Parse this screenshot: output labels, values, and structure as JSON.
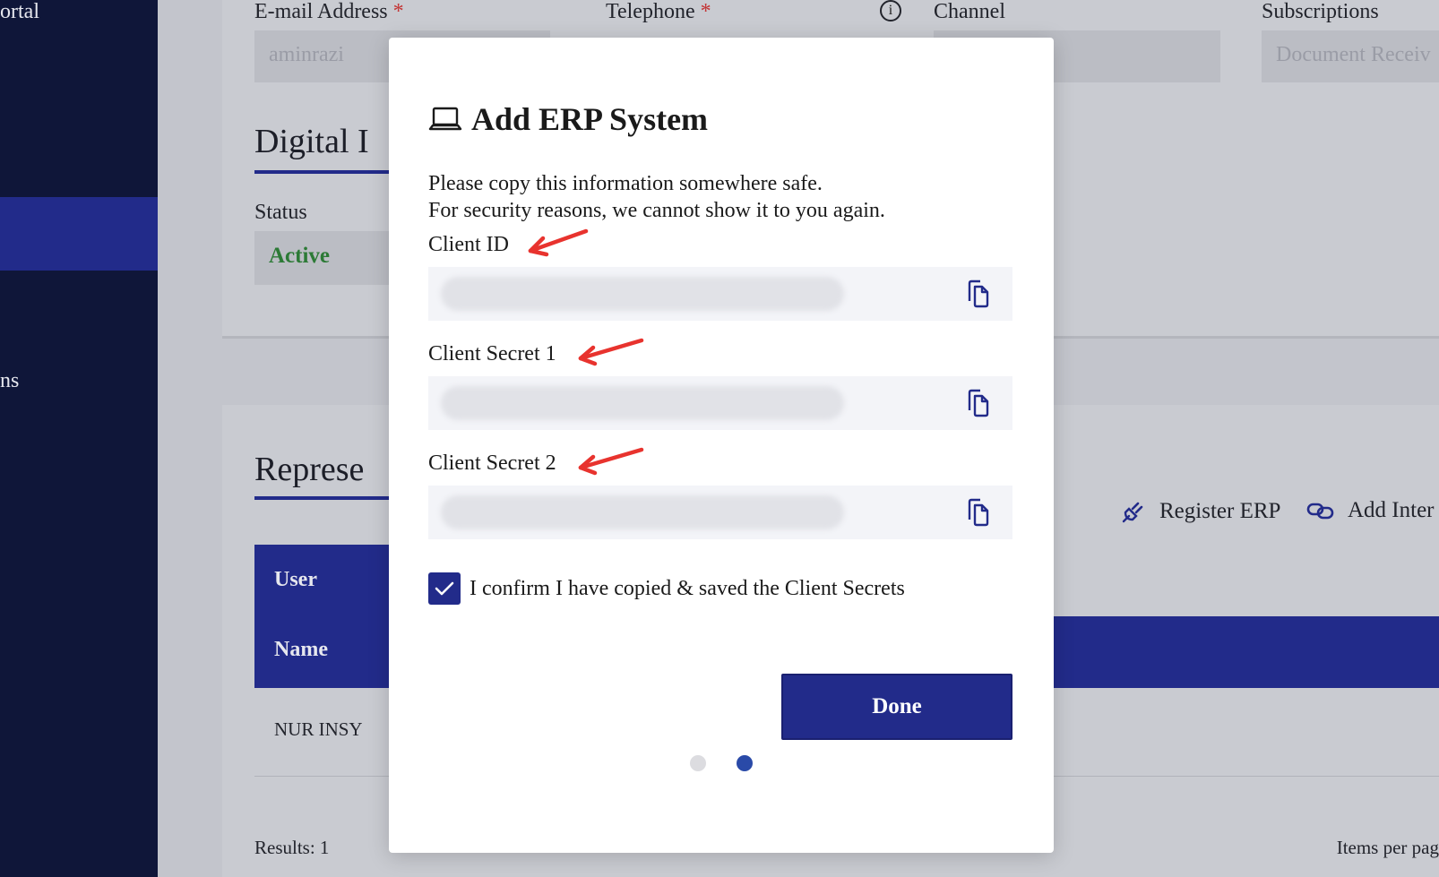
{
  "sidebar": {
    "item_portal": "ortal",
    "item_partial": "ns"
  },
  "form": {
    "email_label": "E-mail Address",
    "email_value": "aminrazi",
    "telephone_label": "Telephone",
    "required_mark": "*",
    "channel_label": "Channel",
    "subscriptions_label": "Subscriptions",
    "subscriptions_value": "Document Receiv"
  },
  "digital": {
    "title": "Digital I",
    "status_label": "Status",
    "status_value": "Active"
  },
  "representatives": {
    "title": "Represe",
    "header_user": "User",
    "header_name": "Name",
    "row_name": "NUR INSY",
    "register_erp": "Register ERP",
    "add_integration": "Add Inter",
    "results": "Results: 1",
    "items_per_page": "Items per pag"
  },
  "modal": {
    "title": "Add ERP System",
    "desc_line1": "Please copy this information somewhere safe.",
    "desc_line2": "For security reasons, we cannot show it to you again.",
    "client_id_label": "Client ID",
    "client_secret1_label": "Client Secret 1",
    "client_secret2_label": "Client Secret 2",
    "confirm_text": "I confirm I have copied & saved the Client Secrets",
    "confirm_checked": true,
    "done_label": "Done",
    "pager": {
      "total": 2,
      "current": 2
    }
  },
  "colors": {
    "primary": "#222b8a",
    "sidebar": "#0f1639",
    "active_status": "#2c7a36",
    "annotation_arrow": "#e8332e"
  },
  "icons": [
    "laptop-icon",
    "copy-icon",
    "check-icon",
    "info-icon",
    "plug-icon",
    "link-icon",
    "arrow-annotation-icon"
  ]
}
